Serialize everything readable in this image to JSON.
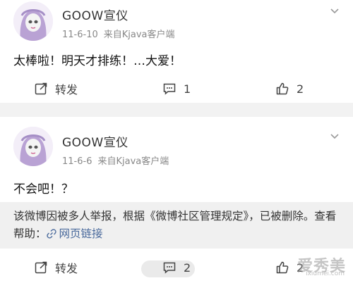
{
  "posts": [
    {
      "author": "GOOW宣仪",
      "date": "11-6-10",
      "source": "来自Kjava客户端",
      "content": "太棒啦！明天才排练！…大爱！",
      "repost_label": "转发",
      "comment_count": "1",
      "like_count": "2"
    },
    {
      "author": "GOOW宣仪",
      "date": "11-6-6",
      "source": "来自Kjava客户端",
      "content": "不会吧！？",
      "notice_text": "该微博因被多人举报，根据《微博社区管理规定》，已被删除。查看帮助：",
      "notice_link": "网页链接",
      "repost_label": "转发",
      "comment_count": "2",
      "like_count": "2"
    }
  ],
  "watermark": {
    "text": "爱秀美",
    "sub": "ixiumei.com"
  },
  "colors": {
    "background": "#f2f2f2",
    "card": "#ffffff",
    "link": "#4a6a9c",
    "meta": "#888888",
    "avatar_hair": "#b9a2d4"
  },
  "icons": [
    "avatar",
    "chevron-down-icon",
    "repost-icon",
    "comment-icon",
    "like-icon",
    "link-icon"
  ]
}
